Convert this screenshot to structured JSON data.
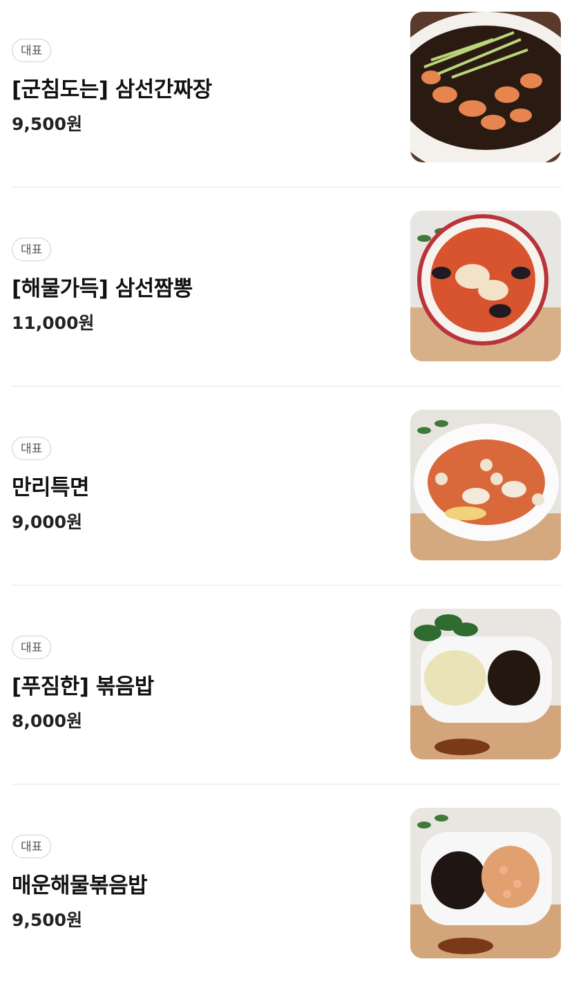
{
  "menu": {
    "items": [
      {
        "badge": "대표",
        "name": "[군침도는] 삼선간짜장",
        "price": "9,500원",
        "image": "jjajang-photo"
      },
      {
        "badge": "대표",
        "name": "[해물가득] 삼선짬뽕",
        "price": "11,000원",
        "image": "jjamppong-photo"
      },
      {
        "badge": "대표",
        "name": "만리특면",
        "price": "9,000원",
        "image": "teukmyeon-photo"
      },
      {
        "badge": "대표",
        "name": "[푸짐한] 볶음밥",
        "price": "8,000원",
        "image": "fried-rice-photo"
      },
      {
        "badge": "대표",
        "name": "매운해물볶음밥",
        "price": "9,500원",
        "image": "spicy-seafood-fried-rice-photo"
      }
    ]
  }
}
